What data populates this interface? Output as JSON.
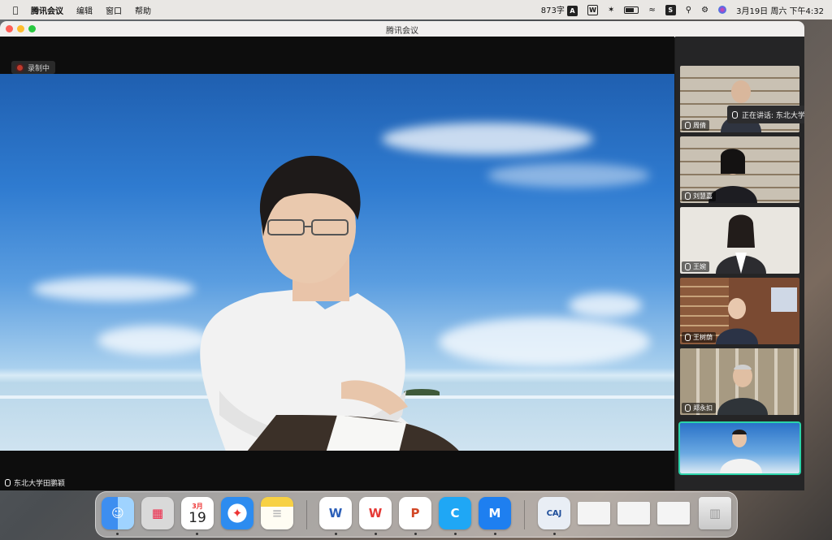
{
  "menubar": {
    "app_name": "腾讯会议",
    "menus": [
      "编辑",
      "窗口",
      "帮助"
    ],
    "word_count": "873字",
    "input_method": "A",
    "datetime": "3月19日 周六 下午4:32"
  },
  "window": {
    "title": "腾讯会议",
    "recording_label": "录制中",
    "active_speaker_name": "东北大学田鹏颖",
    "speaking_now": "正在讲话: 东北大学田鹏颖"
  },
  "participants": [
    {
      "name": "周倩"
    },
    {
      "name": "刘慧嘉"
    },
    {
      "name": "王婉"
    },
    {
      "name": "王树荫"
    },
    {
      "name": "郑永扣"
    },
    {
      "name": ""
    }
  ],
  "dock": {
    "calendar_month": "3月",
    "calendar_day": "19",
    "caj_label": "CAJ",
    "apps": [
      "finder-icon",
      "launchpad-icon",
      "calendar-icon",
      "safari-icon",
      "notes-icon",
      "word-icon",
      "wps-icon",
      "powerpoint-icon",
      "tencent-meeting-icon",
      "lark-icon",
      "caj-viewer-icon",
      "document-thumb-1",
      "document-thumb-2",
      "document-thumb-3",
      "trash-icon"
    ]
  },
  "colors": {
    "active_outline": "#2bd3a9",
    "record_dot": "#c0392b"
  }
}
